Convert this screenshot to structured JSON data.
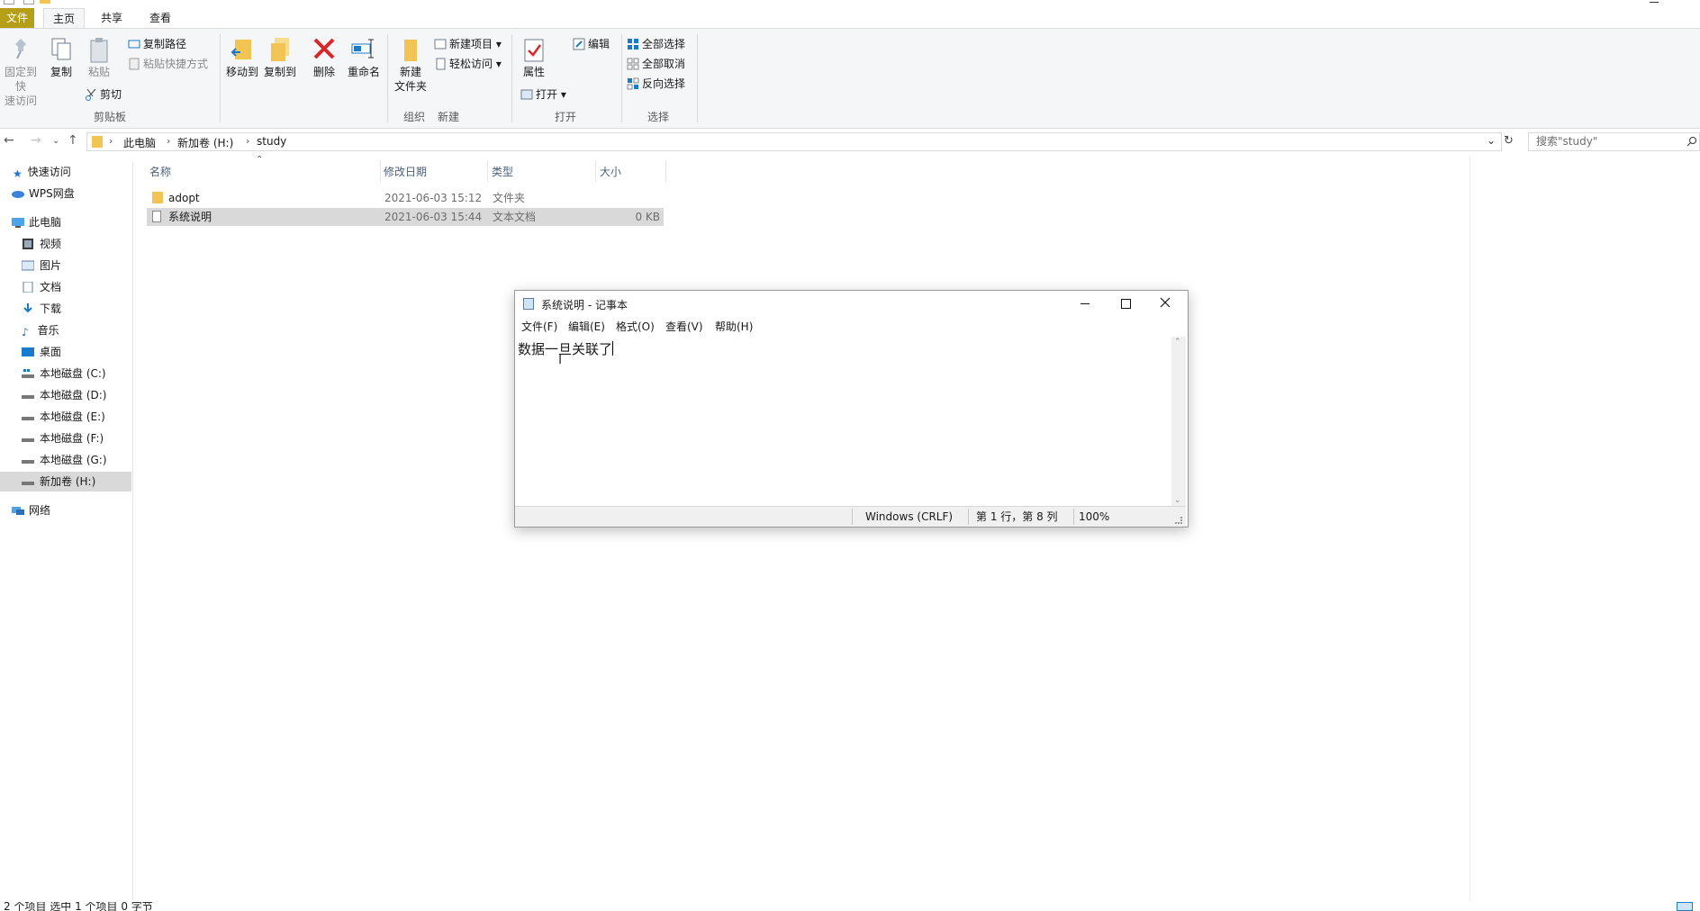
{
  "ribbon": {
    "tabs": {
      "file": "文件",
      "home": "主页",
      "share": "共享",
      "view": "查看"
    },
    "clipboard": {
      "pin_line1": "固定到快",
      "pin_line2": "速访问",
      "copy": "复制",
      "paste": "粘贴",
      "copy_path": "复制路径",
      "paste_shortcut": "粘贴快捷方式",
      "cut": "剪切",
      "group_label": "剪贴板"
    },
    "organize": {
      "move_to": "移动到",
      "copy_to": "复制到",
      "delete": "删除",
      "rename": "重命名",
      "group_label": "组织"
    },
    "new": {
      "new_folder_line1": "新建",
      "new_folder_line2": "文件夹",
      "new_item": "新建项目",
      "easy_access": "轻松访问",
      "group_label": "新建"
    },
    "open": {
      "properties": "属性",
      "open": "打开",
      "edit": "编辑",
      "group_label": "打开"
    },
    "select": {
      "select_all": "全部选择",
      "select_none": "全部取消",
      "invert": "反向选择",
      "group_label": "选择"
    }
  },
  "address": {
    "crumbs": [
      "此电脑",
      "新加卷 (H:)",
      "study"
    ],
    "search_placeholder": "搜索\"study\""
  },
  "nav": {
    "quick_access": "快速访问",
    "wps": "WPS网盘",
    "this_pc": "此电脑",
    "videos": "视频",
    "pictures": "图片",
    "documents": "文档",
    "downloads": "下载",
    "music": "音乐",
    "desktop": "桌面",
    "drive_c": "本地磁盘 (C:)",
    "drive_d": "本地磁盘 (D:)",
    "drive_e": "本地磁盘 (E:)",
    "drive_f": "本地磁盘 (F:)",
    "drive_g": "本地磁盘 (G:)",
    "drive_h": "新加卷 (H:)",
    "network": "网络"
  },
  "filelist": {
    "headers": {
      "name": "名称",
      "modified": "修改日期",
      "type": "类型",
      "size": "大小"
    },
    "rows": [
      {
        "name": "adopt",
        "modified": "2021-06-03 15:12",
        "type": "文件夹",
        "size": ""
      },
      {
        "name": "系统说明",
        "modified": "2021-06-03 15:44",
        "type": "文本文档",
        "size": "0 KB"
      }
    ]
  },
  "notepad": {
    "title": "系统说明 - 记事本",
    "menu": {
      "file": "文件(F)",
      "edit": "编辑(E)",
      "format": "格式(O)",
      "view": "查看(V)",
      "help": "帮助(H)"
    },
    "content": "数据一旦关联了",
    "status": {
      "eol": "Windows (CRLF)",
      "position": "第 1 行，第 8 列",
      "zoom": "100%"
    }
  },
  "statusbar": {
    "text": "2 个项目    选中 1 个项目  0 字节"
  },
  "colors": {
    "file_tab": "#b59f16",
    "selected_row": "#d9d9d9",
    "folder": "#f1c453",
    "accent": "#1979ca"
  }
}
